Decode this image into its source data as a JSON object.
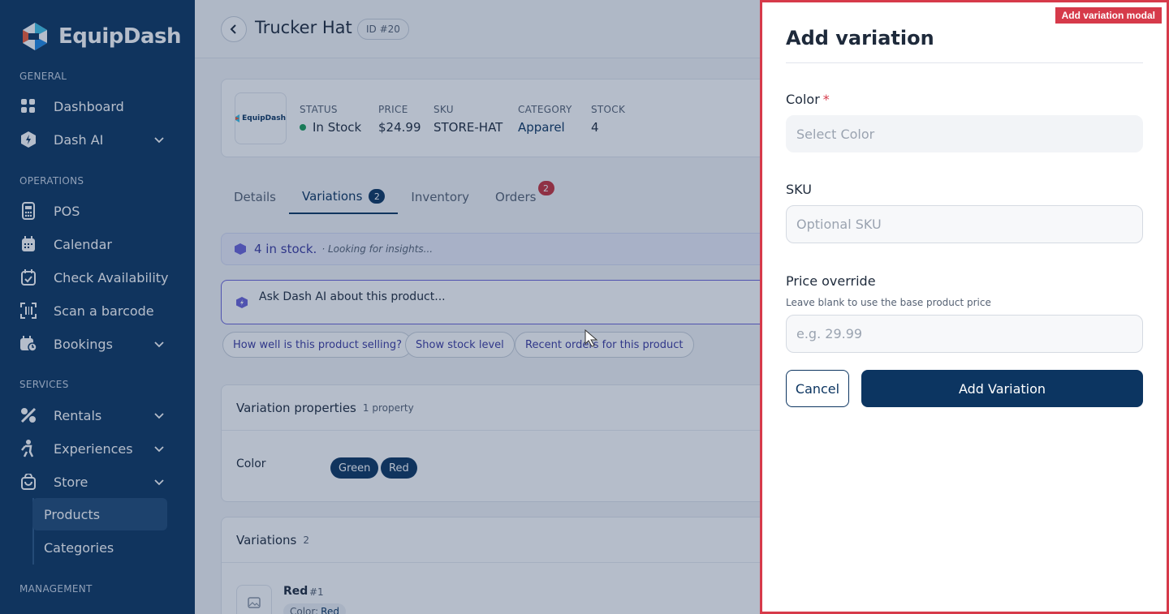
{
  "brand": {
    "name": "EquipDash",
    "thumb_name": "EquipDash"
  },
  "sidebar": {
    "sections": [
      "GENERAL",
      "OPERATIONS",
      "SERVICES",
      "MANAGEMENT"
    ],
    "items": [
      {
        "label": "Dashboard",
        "icon": "grid-icon"
      },
      {
        "label": "Dash AI",
        "icon": "bolt-hex-icon"
      },
      {
        "label": "POS",
        "icon": "pos-terminal-icon"
      },
      {
        "label": "Calendar",
        "icon": "calendar-icon"
      },
      {
        "label": "Check Availability",
        "icon": "calendar-check-icon"
      },
      {
        "label": "Scan a barcode",
        "icon": "barcode-scan-icon"
      },
      {
        "label": "Bookings",
        "icon": "calendar-clock-icon"
      },
      {
        "label": "Rentals",
        "icon": "rentals-icon"
      },
      {
        "label": "Experiences",
        "icon": "person-activity-icon"
      },
      {
        "label": "Store",
        "icon": "shopping-bag-icon"
      }
    ],
    "subitems": [
      {
        "label": "Products"
      },
      {
        "label": "Categories"
      }
    ]
  },
  "header": {
    "title": "Trucker Hat",
    "id_badge": "ID #20"
  },
  "product": {
    "status_label": "STATUS",
    "status_value": "In Stock",
    "price_label": "PRICE",
    "price_value": "$24.99",
    "sku_label": "SKU",
    "sku_value": "STORE-HAT",
    "category_label": "CATEGORY",
    "category_value": "Apparel",
    "stock_label": "STOCK",
    "stock_value": "4"
  },
  "tabs": [
    {
      "label": "Details"
    },
    {
      "label": "Variations",
      "count": "2"
    },
    {
      "label": "Inventory"
    },
    {
      "label": "Orders",
      "count": "2"
    }
  ],
  "ai": {
    "insight_bold": "4 in stock.",
    "insight_italic": "· Looking for insights...",
    "prompt_placeholder": "Ask Dash AI about this product...",
    "chips": [
      "How well is this product selling?",
      "Show stock level",
      "Recent orders for this product"
    ]
  },
  "variation_properties": {
    "title": "Variation properties",
    "count_text": "1 property",
    "property_name": "Color",
    "values": [
      "Green",
      "Red"
    ]
  },
  "variations": {
    "title": "Variations",
    "count": "2",
    "items": [
      {
        "name": "Red",
        "num": "#1",
        "tag_label": "Color:",
        "tag_value": "Red"
      }
    ]
  },
  "modal": {
    "tag": "Add variation modal",
    "title": "Add variation",
    "color_label": "Color",
    "required_mark": "*",
    "color_placeholder": "Select Color",
    "sku_label": "SKU",
    "sku_placeholder": "Optional SKU",
    "price_label": "Price override",
    "price_help": "Leave blank to use the base product price",
    "price_placeholder": "e.g. 29.99",
    "cancel_label": "Cancel",
    "submit_label": "Add Variation"
  },
  "colors": {
    "sidebar_bg": "#0c3561",
    "accent": "#0c3561",
    "danger": "#d63a4a",
    "ai_purple": "#6a63d9",
    "success": "#1a9c58"
  }
}
